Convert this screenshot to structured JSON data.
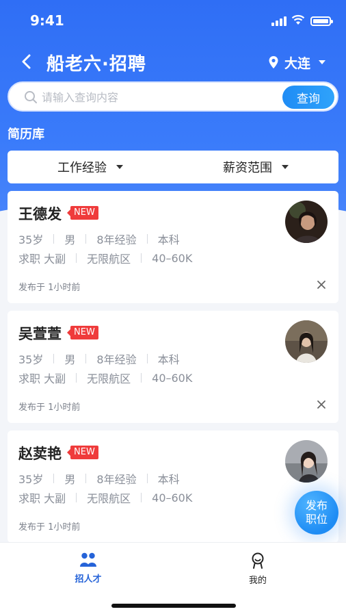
{
  "status_bar": {
    "time": "9:41"
  },
  "nav": {
    "title": "船老六·招聘",
    "city": "大连"
  },
  "search": {
    "placeholder": "请输入查询内容",
    "value": "",
    "button_label": "查询"
  },
  "section_title": "简历库",
  "filters": [
    {
      "label": "工作经验"
    },
    {
      "label": "薪资范围"
    }
  ],
  "resumes": [
    {
      "name": "王德发",
      "badge": "NEW",
      "age": "35岁",
      "gender": "男",
      "experience": "8年经验",
      "education": "本科",
      "job_label": "求职",
      "position": "大副",
      "area": "无限航区",
      "salary": "40–60K",
      "posted": "发布于 1小时前",
      "avatar_color": "#3a2a22"
    },
    {
      "name": "吴萱萱",
      "badge": "NEW",
      "age": "35岁",
      "gender": "男",
      "experience": "8年经验",
      "education": "本科",
      "job_label": "求职",
      "position": "大副",
      "area": "无限航区",
      "salary": "40–60K",
      "posted": "发布于 1小时前",
      "avatar_color": "#6b5a4a"
    },
    {
      "name": "赵荬艳",
      "badge": "NEW",
      "age": "35岁",
      "gender": "男",
      "experience": "8年经验",
      "education": "本科",
      "job_label": "求职",
      "position": "大副",
      "area": "无限航区",
      "salary": "40–60K",
      "posted": "发布于 1小时前",
      "avatar_color": "#8e8f95"
    }
  ],
  "fab": {
    "line1": "发布",
    "line2": "职位"
  },
  "tabbar": {
    "items": [
      {
        "label": "招人才",
        "icon": "people-icon",
        "active": true
      },
      {
        "label": "我的",
        "icon": "person-icon",
        "active": false
      }
    ]
  },
  "colors": {
    "brand": "#2f6ef5",
    "badge": "#ef3b3b",
    "active_tab": "#2563d8"
  }
}
